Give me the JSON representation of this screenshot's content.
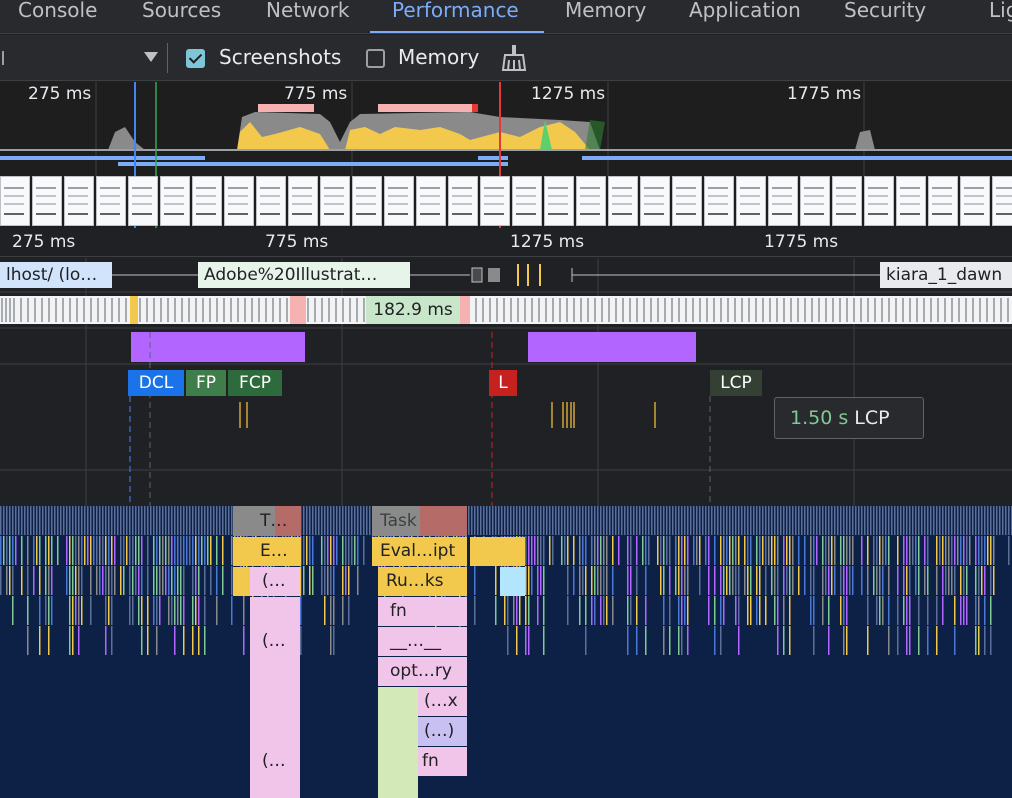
{
  "tabs": [
    {
      "label": "Console",
      "active": false
    },
    {
      "label": "Sources",
      "active": false
    },
    {
      "label": "Network",
      "active": false
    },
    {
      "label": "Performance",
      "active": true
    },
    {
      "label": "Memory",
      "active": false
    },
    {
      "label": "Application",
      "active": false
    },
    {
      "label": "Security",
      "active": false
    },
    {
      "label": "Lig",
      "active": false
    }
  ],
  "toolbar": {
    "screenshots_label": "Screenshots",
    "screenshots_checked": true,
    "memory_label": "Memory",
    "memory_checked": false,
    "gc_icon": "broom-icon"
  },
  "overview": {
    "ticks": [
      "275 ms",
      "775 ms",
      "1275 ms",
      "1775 ms"
    ]
  },
  "timeline": {
    "ticks": [
      "275 ms",
      "775 ms",
      "1275 ms",
      "1775 ms"
    ],
    "network": [
      {
        "label": "lhost/ (lo…"
      },
      {
        "label": "Adobe%20Illustrat…"
      },
      {
        "label": "kiara_1_dawn"
      }
    ],
    "frame_duration": "182.9 ms",
    "markers": [
      {
        "label": "DCL",
        "color": "#1a73e8"
      },
      {
        "label": "FP",
        "color": "#3f7d4a"
      },
      {
        "label": "FCP",
        "color": "#2e6b3c"
      },
      {
        "label": "L",
        "color": "#c5221f"
      },
      {
        "label": "LCP",
        "color": "#344034"
      }
    ],
    "tooltip": {
      "value": "1.50 s",
      "label": "LCP"
    }
  },
  "flame": {
    "labels": [
      "T…",
      "Task",
      "E…",
      "Eval…ipt",
      "(…",
      "Ru…ks",
      "fn",
      "(…",
      "__…__",
      "opt…ry",
      "(…x",
      "(…)",
      "(…",
      "fn"
    ]
  },
  "colors": {
    "accent": "#7cacf8",
    "scripting": "#f2c94c",
    "rendering": "#b366ff",
    "painting": "#81c995",
    "idle": "#0d2147"
  }
}
